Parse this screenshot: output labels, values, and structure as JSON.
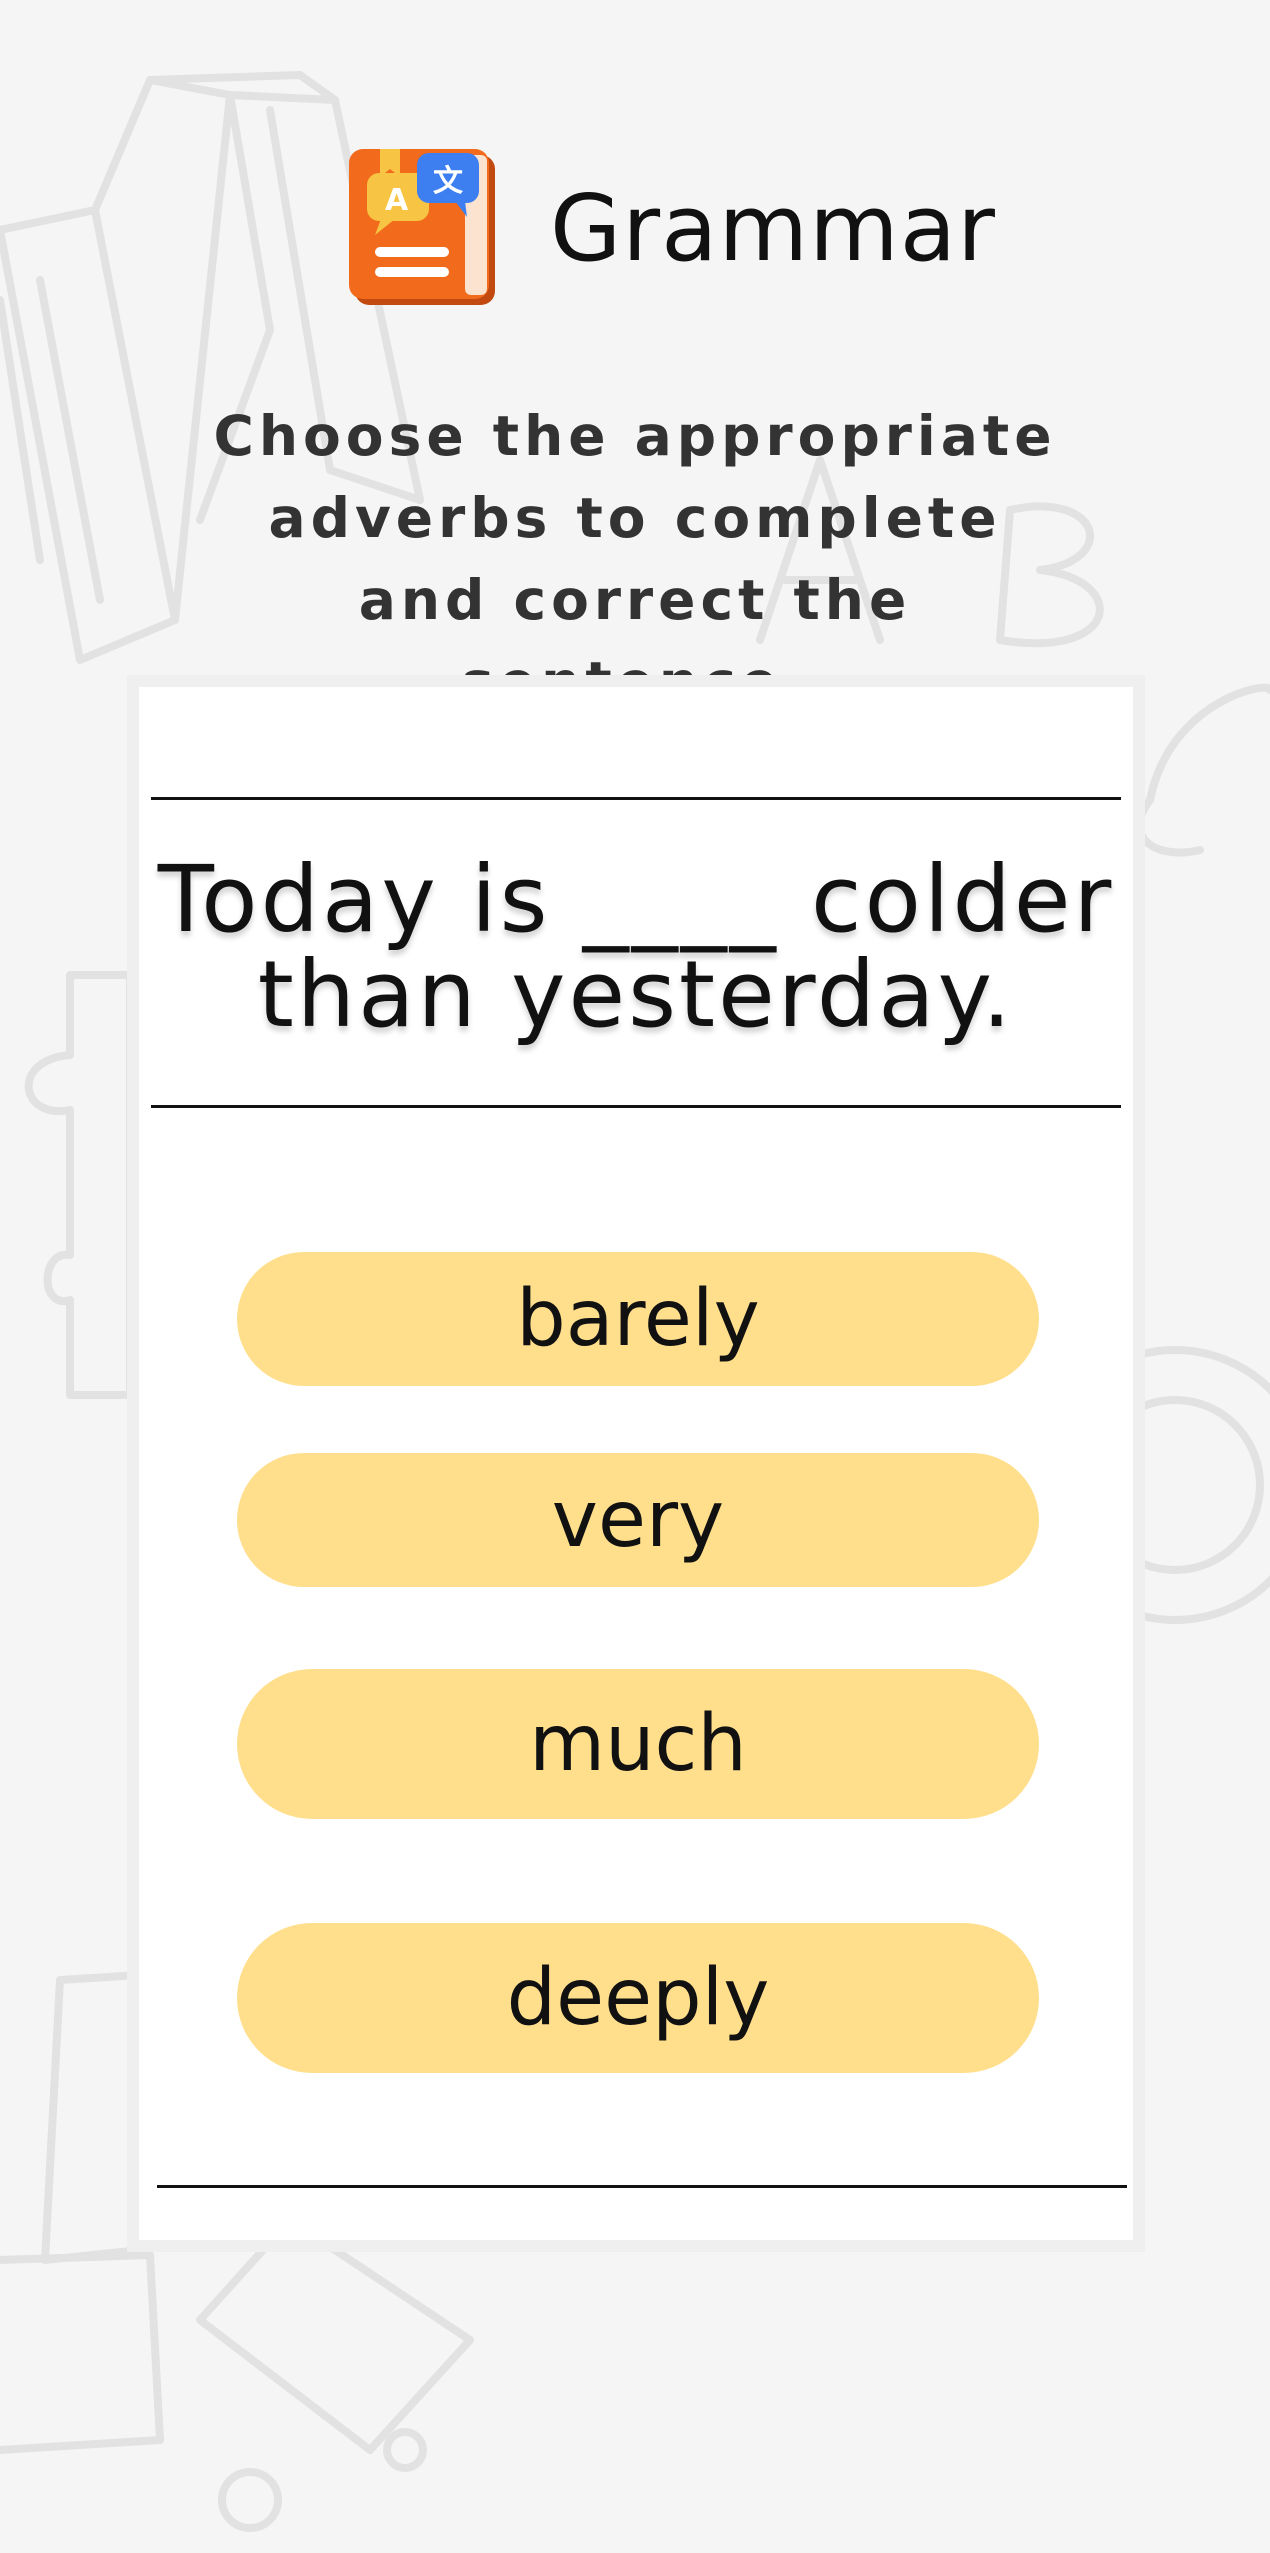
{
  "header": {
    "title": "Grammar",
    "icon": "language-book-icon"
  },
  "instruction": "Choose the appropriate adverbs to complete and correct the sentence.",
  "question": {
    "sentence": "Today is ____ colder than yesterday."
  },
  "options": [
    {
      "label": "barely"
    },
    {
      "label": "very"
    },
    {
      "label": "much"
    },
    {
      "label": "deeply"
    }
  ],
  "colors": {
    "background": "#f5f5f5",
    "option_fill": "#ffdf8c",
    "icon_book": "#f26a1b",
    "icon_bubble_blue": "#3d7ff0",
    "icon_bubble_yellow": "#f7c443"
  }
}
